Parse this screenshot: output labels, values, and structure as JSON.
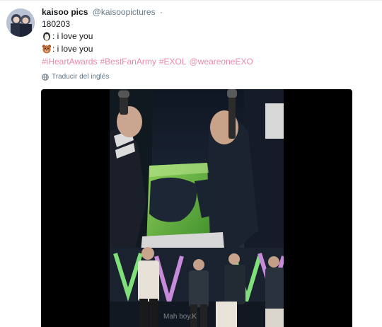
{
  "tweet": {
    "display_name": "kaisoo pics",
    "handle": "@kaisoopictures",
    "separator": "·",
    "lines": [
      {
        "text": "180203"
      },
      {
        "emoji": "penguin-emoji",
        "text": ": i love you"
      },
      {
        "emoji": "bear-emoji",
        "text": ": i love you"
      }
    ],
    "hashtags": [
      "#iHeartAwards",
      "#BestFanArmy",
      "#EXOL",
      "@weareoneEXO"
    ],
    "translate_label": "Traducir del inglés",
    "video_watermark": "Mah boy.K"
  },
  "colors": {
    "text": "#14171a",
    "muted": "#657786",
    "hashtag": "#e0245e",
    "media_bg": "#000000"
  },
  "icons": {
    "translate": "globe-icon"
  }
}
